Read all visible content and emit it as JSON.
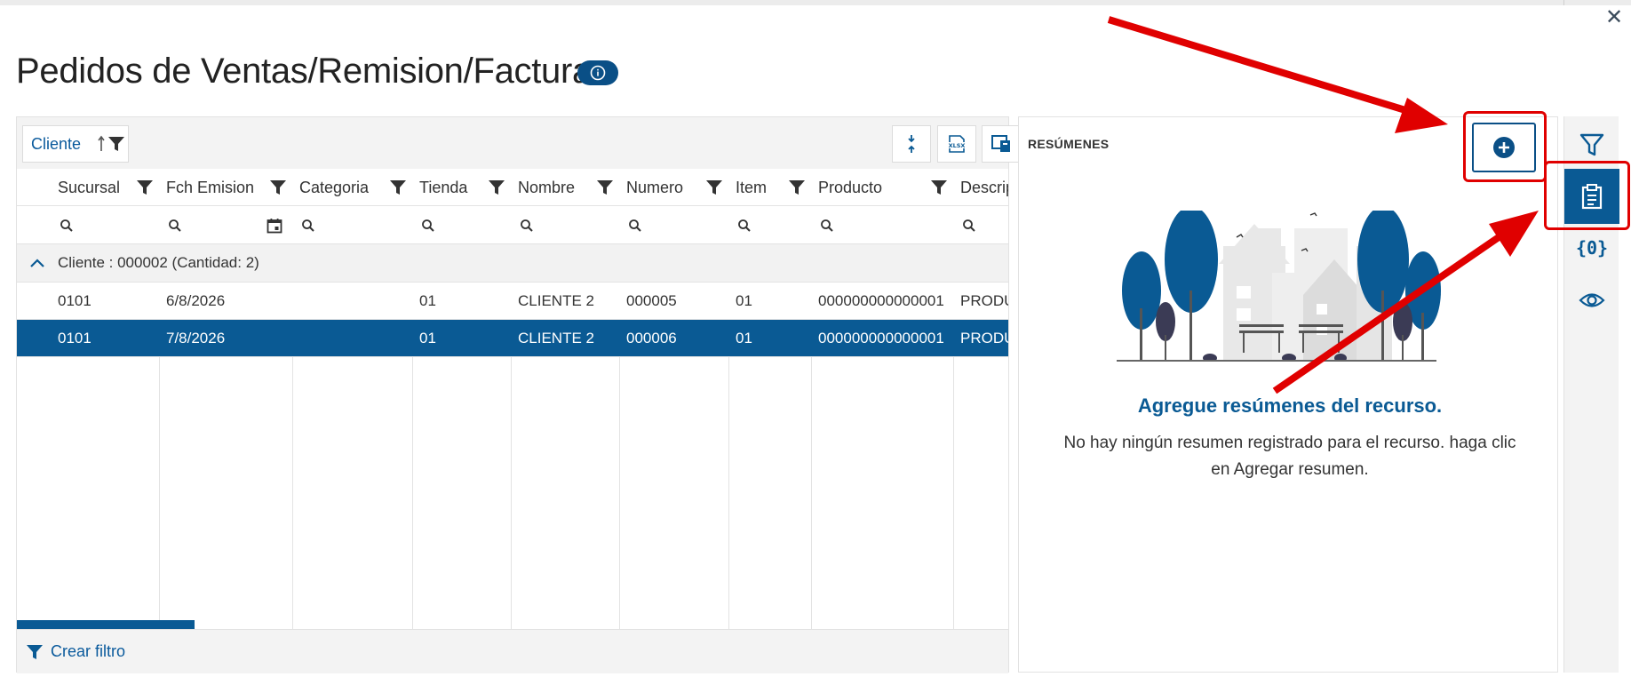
{
  "window": {
    "close_label": "✕"
  },
  "page": {
    "title": "Pedidos de Ventas/Remision/Factura"
  },
  "toolbar": {
    "group_chip_label": "Cliente"
  },
  "grid": {
    "columns": [
      {
        "label": "Sucursal"
      },
      {
        "label": "Fch Emision"
      },
      {
        "label": "Categoria"
      },
      {
        "label": "Tienda"
      },
      {
        "label": "Nombre"
      },
      {
        "label": "Numero"
      },
      {
        "label": "Item"
      },
      {
        "label": "Producto"
      },
      {
        "label": "Descrip"
      }
    ],
    "group_row": {
      "label": "Cliente : 000002 (Cantidad: 2)"
    },
    "rows": [
      {
        "sucursal": "0101",
        "fch": "6/8/2026",
        "categoria": "",
        "tienda": "01",
        "nombre": "CLIENTE 2",
        "numero": "000005",
        "item": "01",
        "producto": "000000000000001",
        "descrip": "PRODU"
      },
      {
        "sucursal": "0101",
        "fch": "7/8/2026",
        "categoria": "",
        "tienda": "01",
        "nombre": "CLIENTE 2",
        "numero": "000006",
        "item": "01",
        "producto": "000000000000001",
        "descrip": "PRODU"
      }
    ],
    "footer": {
      "create_filter_label": "Crear filtro"
    }
  },
  "summaries": {
    "title": "RESÚMENES",
    "empty_title": "Agregue resúmenes del recurso.",
    "empty_desc": "No hay ningún resumen registrado para el recurso. haga clic en Agregar resumen."
  },
  "sidebar": {
    "braces_label": "{0}"
  },
  "colors": {
    "accent": "#0a5a94",
    "annotation": "#e00000"
  }
}
